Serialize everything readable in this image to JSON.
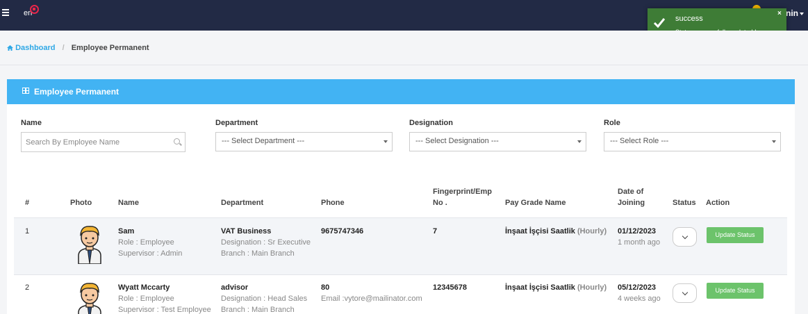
{
  "nav": {
    "logo_text": "en",
    "user_label": "nin"
  },
  "toast": {
    "title": "success",
    "message": "Status successfully updated !",
    "close": "×"
  },
  "breadcrumb": {
    "home": "Dashboard",
    "separator": "/",
    "current": "Employee Permanent"
  },
  "card": {
    "title": "Employee Permanent"
  },
  "filters": {
    "name": {
      "label": "Name",
      "placeholder": "Search By Employee Name"
    },
    "department": {
      "label": "Department",
      "value": "--- Select Department ---"
    },
    "designation": {
      "label": "Designation",
      "value": "--- Select Designation ---"
    },
    "role": {
      "label": "Role",
      "value": "--- Select Role ---"
    }
  },
  "table": {
    "headers": {
      "num": "#",
      "photo": "Photo",
      "name": "Name",
      "department": "Department",
      "phone": "Phone",
      "fingerprint_1": "Fingerprint/Emp",
      "fingerprint_2": "No .",
      "pay_grade": "Pay Grade Name",
      "doj_1": "Date of",
      "doj_2": "Joining",
      "status": "Status",
      "action": "Action"
    },
    "rows": [
      {
        "num": "1",
        "name": "Sam",
        "role": "Role : Employee",
        "supervisor": "Supervisor : Admin",
        "department": "VAT Business",
        "designation": "Designation : Sr Executive",
        "branch": "Branch : Main Branch",
        "phone": "9675747346",
        "email": "",
        "fingerprint": "7",
        "pay_grade": "İnşaat İşçisi Saatlik",
        "pay_type": "(Hourly)",
        "date": "01/12/2023",
        "ago": "1 month ago",
        "action": "Update Status"
      },
      {
        "num": "2",
        "name": "Wyatt Mccarty",
        "role": "Role : Employee",
        "supervisor": "Supervisor : Test Employee",
        "department": "advisor",
        "designation": "Designation : Head Sales",
        "branch": "Branch : Main Branch",
        "phone": "80",
        "email": "Email :vytore@mailinator.com",
        "fingerprint": "12345678",
        "pay_grade": "İnşaat İşçisi Saatlik",
        "pay_type": "(Hourly)",
        "date": "05/12/2023",
        "ago": "4 weeks ago",
        "action": "Update Status"
      }
    ]
  },
  "colors": {
    "navbar": "#222a45",
    "card_header": "#42b3f3",
    "toast": "#3e7c36",
    "update_button": "#6cc36b",
    "link": "#2fa8e6"
  },
  "icons": {
    "menu": "hamburger-icon",
    "home": "home-icon",
    "grid": "grid-icon",
    "search": "search-icon",
    "toast": "check-icon"
  }
}
